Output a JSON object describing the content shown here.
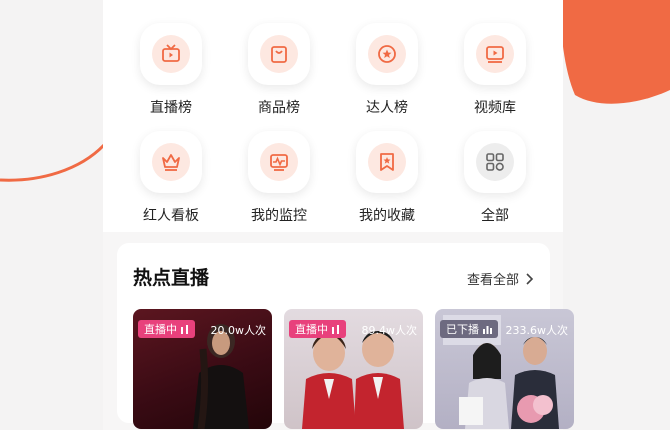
{
  "menu": {
    "items": [
      {
        "label": "直播榜",
        "icon": "tv-icon"
      },
      {
        "label": "商品榜",
        "icon": "shopping-bag-icon"
      },
      {
        "label": "达人榜",
        "icon": "star-badge-icon"
      },
      {
        "label": "视频库",
        "icon": "video-player-icon"
      },
      {
        "label": "红人看板",
        "icon": "crown-icon"
      },
      {
        "label": "我的监控",
        "icon": "monitor-chart-icon"
      },
      {
        "label": "我的收藏",
        "icon": "bookmark-star-icon"
      },
      {
        "label": "全部",
        "icon": "grid-icon"
      }
    ]
  },
  "hot_live": {
    "title": "热点直播",
    "more_label": "查看全部",
    "cards": [
      {
        "status": "直播中",
        "viewers": "20.0w人次"
      },
      {
        "status": "直播中",
        "viewers": "89.4w人次"
      },
      {
        "status": "已下播",
        "viewers": "233.6w人次"
      }
    ]
  },
  "colors": {
    "accent": "#f06a44",
    "icon_bg": "#fde8e1",
    "live_badge": "#e8417c",
    "ended_badge": "#6d6a80"
  }
}
